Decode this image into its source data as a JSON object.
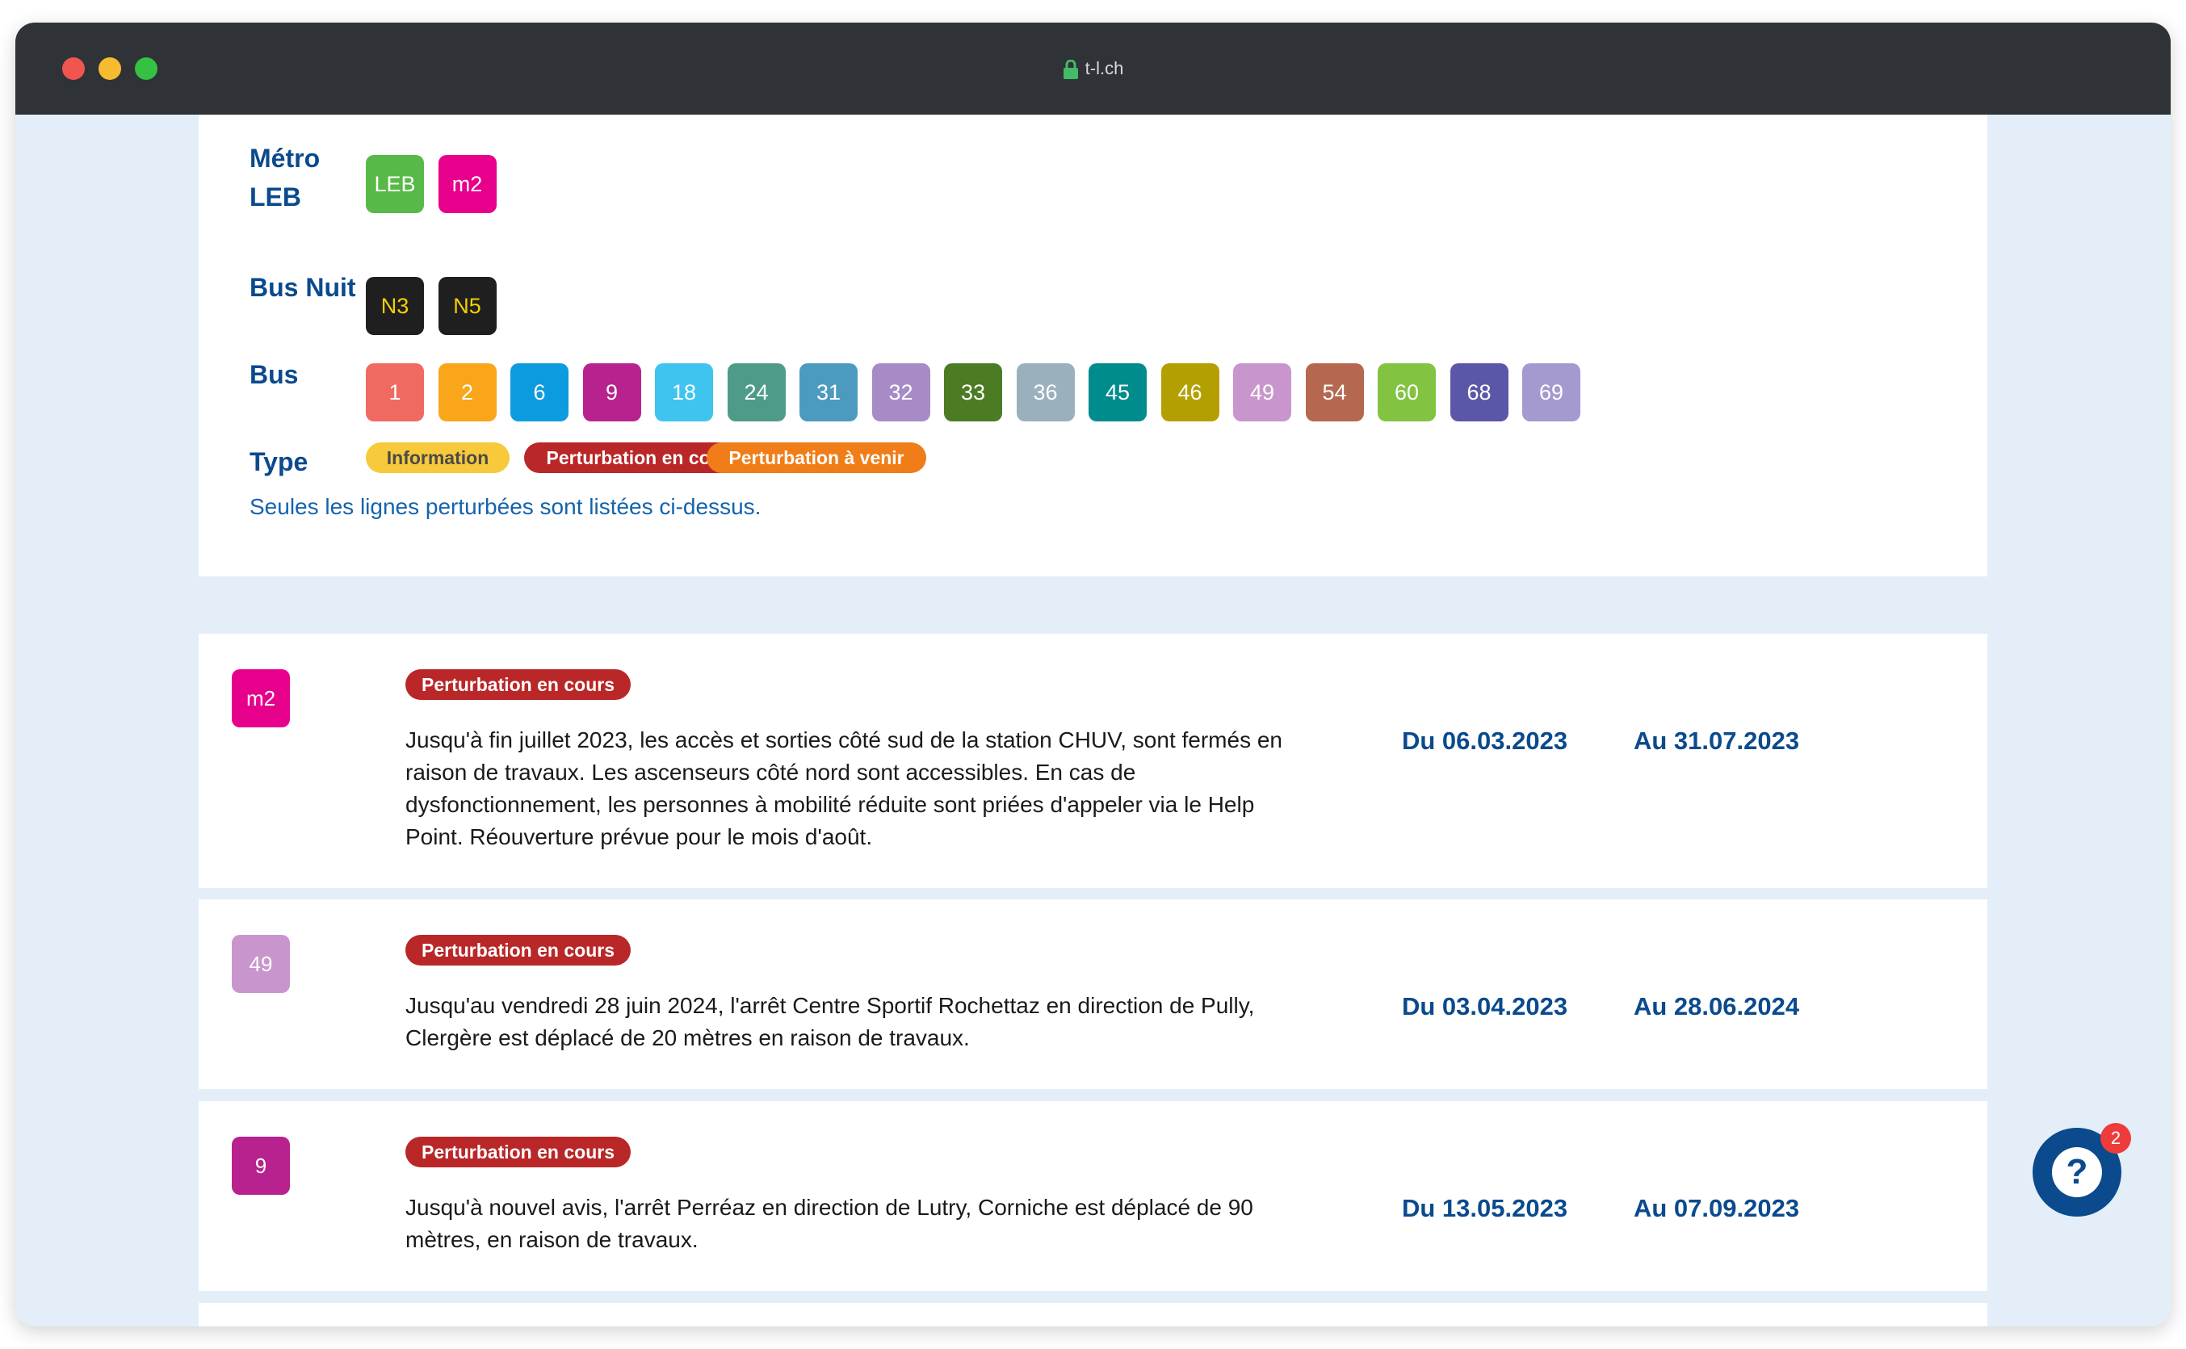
{
  "browser": {
    "url": "t-l.ch"
  },
  "filters": {
    "metro": {
      "label_line1": "Métro",
      "label_line2": "LEB",
      "lines": [
        "LEB",
        "m2"
      ]
    },
    "bus_nuit": {
      "label": "Bus Nuit",
      "lines": [
        "N3",
        "N5"
      ]
    },
    "bus": {
      "label": "Bus",
      "lines": [
        "1",
        "2",
        "6",
        "9",
        "18",
        "24",
        "31",
        "32",
        "33",
        "36",
        "45",
        "46",
        "49",
        "54",
        "60",
        "68",
        "69"
      ]
    },
    "type": {
      "label": "Type",
      "tags": [
        "Information",
        "Perturbation en cours",
        "Perturbation à venir"
      ]
    },
    "note": "Seules les lignes perturbées sont listées ci-dessus."
  },
  "colors": {
    "metro": [
      "#57b947",
      "#e6008c"
    ],
    "bus_nuit_bg": "#1f1f1f",
    "bus_nuit_text": "#f5d000",
    "bus": [
      "#f06a62",
      "#f9a61a",
      "#0d9be0",
      "#b7228e",
      "#3fc4ef",
      "#4f9b8a",
      "#4d9ac0",
      "#a78bc6",
      "#4b7b23",
      "#9ab0bd",
      "#008c8c",
      "#b49f00",
      "#c896cc",
      "#b5684f",
      "#82c341",
      "#5a57a8",
      "#a59ad0"
    ],
    "type_tags": [
      {
        "bg": "#f7c93b",
        "text": "#4a4a4a"
      },
      {
        "bg": "#b92728",
        "text": "#ffffff"
      },
      {
        "bg": "#f07d17",
        "text": "#ffffff"
      }
    ]
  },
  "disruptions": [
    {
      "line": "m2",
      "color": "#e6008c",
      "status": "Perturbation en cours",
      "description": "Jusqu'à fin juillet 2023, les accès et sorties côté sud de la station CHUV, sont fermés en raison de travaux. Les ascenseurs côté nord sont accessibles. En cas de dysfonctionnement, les personnes à mobilité réduite sont priées d'appeler via le Help Point. Réouverture prévue pour le mois d'août.",
      "from": "Du 06.03.2023",
      "to": "Au 31.07.2023"
    },
    {
      "line": "49",
      "color": "#c896cc",
      "status": "Perturbation en cours",
      "description": "Jusqu'au vendredi 28 juin 2024, l'arrêt Centre Sportif Rochettaz en direction de Pully, Clergère est déplacé de 20 mètres en raison de travaux.",
      "from": "Du 03.04.2023",
      "to": "Au 28.06.2024"
    },
    {
      "line": "9",
      "color": "#b7228e",
      "status": "Perturbation en cours",
      "description": "Jusqu'à nouvel avis, l'arrêt Perréaz en direction de Lutry, Corniche est déplacé de 90 mètres, en raison de travaux.",
      "from": "Du 13.05.2023",
      "to": "Au 07.09.2023"
    },
    {
      "line": "",
      "color": "#0d9be0",
      "status": "",
      "description": "",
      "from": "",
      "to": ""
    }
  ],
  "help_widget": {
    "glyph": "?",
    "badge": "2"
  }
}
